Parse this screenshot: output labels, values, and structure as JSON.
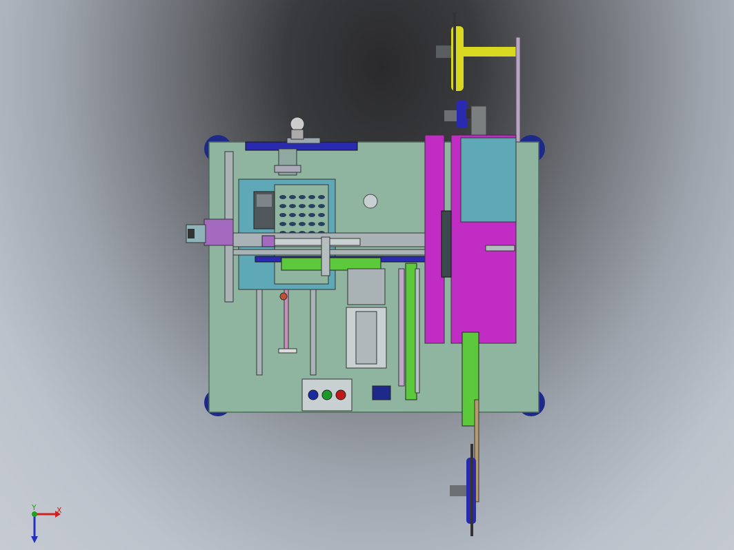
{
  "view": {
    "type": "cad-assembly-top-view",
    "background_colors": [
      "#2a2a2c",
      "#6c6f75",
      "#c6cbd3"
    ]
  },
  "colors": {
    "base_plate": "#8fb5a0",
    "plate_edge": "#4f6b5c",
    "magenta": "#c02cc4",
    "teal": "#5ea8b8",
    "blue": "#2a2ab0",
    "navy": "#1e2a8a",
    "yellow": "#d8d820",
    "green": "#5cc83c",
    "purple": "#a46ac0",
    "tan": "#b79a6a",
    "steel": "#a9b3b6",
    "dark_steel": "#6d7578"
  },
  "triad": {
    "x_label": "X",
    "y_label": "Y",
    "x_color": "#d02020",
    "y_color": "#20a020",
    "z_color": "#2030c0"
  },
  "control_panel": {
    "buttons": [
      {
        "name": "blue-button",
        "color": "#1a2aa0"
      },
      {
        "name": "green-button",
        "color": "#1a9a2a"
      },
      {
        "name": "red-button",
        "color": "#c01818"
      }
    ]
  },
  "feeder_slots": {
    "rows": 5,
    "columns": 5,
    "color": "#2a4060"
  }
}
